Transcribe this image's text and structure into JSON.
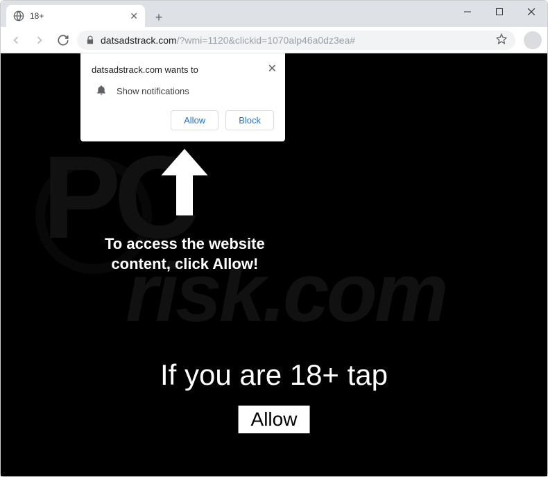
{
  "window": {
    "minimize": "–",
    "maximize": "☐",
    "close": "✕"
  },
  "tab": {
    "title": "18+",
    "close": "✕"
  },
  "newtab": "+",
  "toolbar": {
    "url_domain": "datsadstrack.com",
    "url_path": "/?wmi=1120&clickid=1070alp46a0dz3ea#"
  },
  "permission": {
    "title": "datsadstrack.com wants to",
    "row": "Show notifications",
    "allow": "Allow",
    "block": "Block",
    "close": "✕"
  },
  "page": {
    "arrow_text_l1": "To access the website",
    "arrow_text_l2": "content, click Allow!",
    "big_text": "If you are 18+ tap",
    "allow_button": "Allow"
  },
  "watermark": {
    "pc": "PC",
    "risk": "risk.com"
  }
}
